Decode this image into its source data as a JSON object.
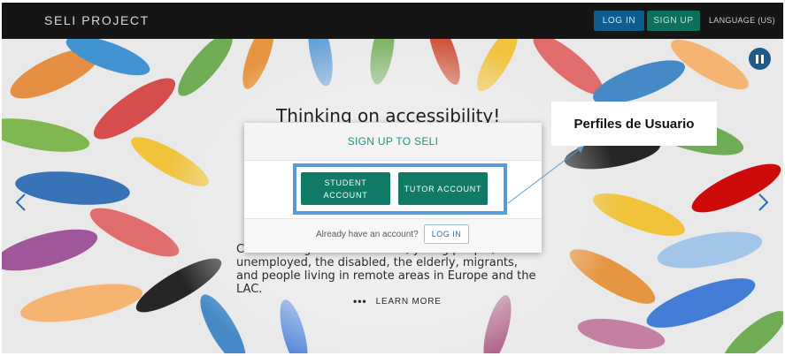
{
  "navbar": {
    "brand": "SELI PROJECT",
    "login_label": "LOG IN",
    "signup_label": "SIGN UP",
    "language_label": "LANGUAGE (US)"
  },
  "hero": {
    "title": "Thinking on accessibility!",
    "description": "Course designed for students, young people, the unemployed, the disabled, the elderly, migrants, and people living in remote areas in Europe and the LAC.",
    "learn_more_label": "LEARN MORE"
  },
  "modal": {
    "title": "SIGN UP TO SELI",
    "student_button": "STUDENT ACCOUNT",
    "tutor_button": "TUTOR ACCOUNT",
    "footer_text": "Already have an account?",
    "footer_login": "LOG IN"
  },
  "annotation": {
    "label": "Perfiles de Usuario"
  },
  "icons": {
    "pause": "pause-icon",
    "prev": "chevron-left-icon",
    "next": "chevron-right-icon",
    "more": "dots-icon"
  },
  "colors": {
    "navbar_bg": "#151515",
    "login_blue": "#0f5c8f",
    "signup_green": "#0e6f5c",
    "account_button": "#0f7a66",
    "modal_title": "#1f8f84",
    "highlight": "#5b9bd5"
  }
}
